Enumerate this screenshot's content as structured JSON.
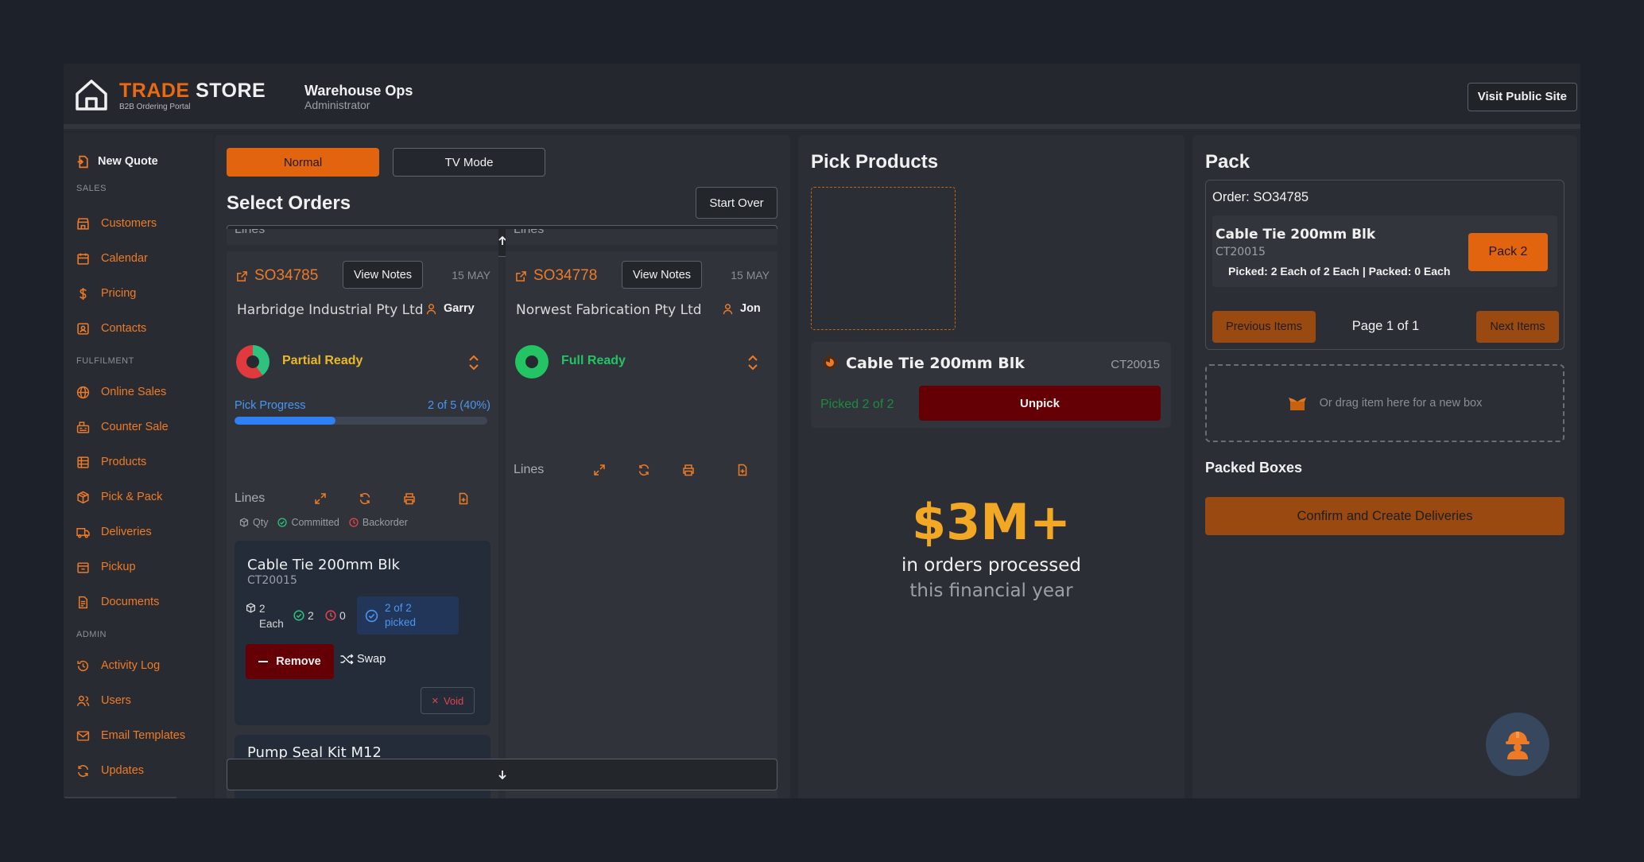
{
  "header": {
    "logo_primary": "TRADE",
    "logo_secondary": "STORE",
    "logo_subtitle": "B2B Ordering Portal",
    "workspace_title": "Warehouse Ops",
    "workspace_role": "Administrator",
    "visit_site_label": "Visit Public Site"
  },
  "sidebar": {
    "new_quote": "New Quote",
    "sections": {
      "sales": "SALES",
      "fulfilment": "FULFILMENT",
      "admin": "ADMIN"
    },
    "sales_items": [
      "Customers",
      "Calendar",
      "Pricing",
      "Contacts"
    ],
    "fulfilment_items": [
      "Online Sales",
      "Counter Sale",
      "Products",
      "Pick & Pack",
      "Deliveries",
      "Pickup",
      "Documents"
    ],
    "admin_items": [
      "Activity Log",
      "Users",
      "Email Templates",
      "Updates"
    ]
  },
  "orders_panel": {
    "mode_normal": "Normal",
    "mode_tv": "TV Mode",
    "title": "Select Orders",
    "start_over": "Start Over",
    "ghost_lines_label": "Lines",
    "lines_label": "Lines",
    "legend": {
      "qty": "Qty",
      "committed": "Committed",
      "backorder": "Backorder"
    },
    "orders": [
      {
        "number": "SO34785",
        "notes_label": "View Notes",
        "date": "15 MAY",
        "customer": "Harbridge Industrial Pty Ltd",
        "assignee": "Garry",
        "status": "Partial Ready",
        "status_color": "#e8b82a",
        "progress_label": "Pick Progress",
        "progress_text": "2 of 5 (40%)",
        "progress_fraction": 0.4,
        "lines": [
          {
            "name": "Cable Tie 200mm Blk",
            "sku": "CT20015",
            "qty_value": "2",
            "qty_unit": "Each",
            "committed": "2",
            "backorder": "0",
            "picked_line1": "2 of 2",
            "picked_line2": "picked",
            "remove_label": "Remove",
            "swap_label": "Swap",
            "void_label": "Void"
          },
          {
            "name": "Pump Seal Kit M12"
          }
        ]
      },
      {
        "number": "SO34778",
        "notes_label": "View Notes",
        "date": "15 MAY",
        "customer": "Norwest Fabrication Pty Ltd",
        "assignee": "Jon",
        "status": "Full Ready",
        "status_color": "#23c463"
      }
    ]
  },
  "pick_panel": {
    "title": "Pick Products",
    "item_name": "Cable Tie 200mm Blk",
    "item_sku": "CT20015",
    "picked_text": "Picked 2 of 2",
    "unpick_label": "Unpick",
    "stat_value": "$3M+",
    "stat_line1": "in orders processed",
    "stat_line2": "this financial year"
  },
  "pack_panel": {
    "title": "Pack",
    "order_label": "Order: SO34785",
    "item_name": "Cable Tie 200mm Blk",
    "item_sku": "CT20015",
    "item_status": "Picked: 2 Each of 2 Each | Packed: 0 Each",
    "pack_button": "Pack 2",
    "prev_label": "Previous Items",
    "page_text": "Page 1 of 1",
    "next_label": "Next Items",
    "drop_hint": "Or drag item here for a new box",
    "packed_title": "Packed Boxes",
    "confirm_label": "Confirm and Create Deliveries"
  },
  "colors": {
    "accent": "#e2640f",
    "danger": "#640005",
    "info": "#4a95f0",
    "success": "#23c463"
  }
}
